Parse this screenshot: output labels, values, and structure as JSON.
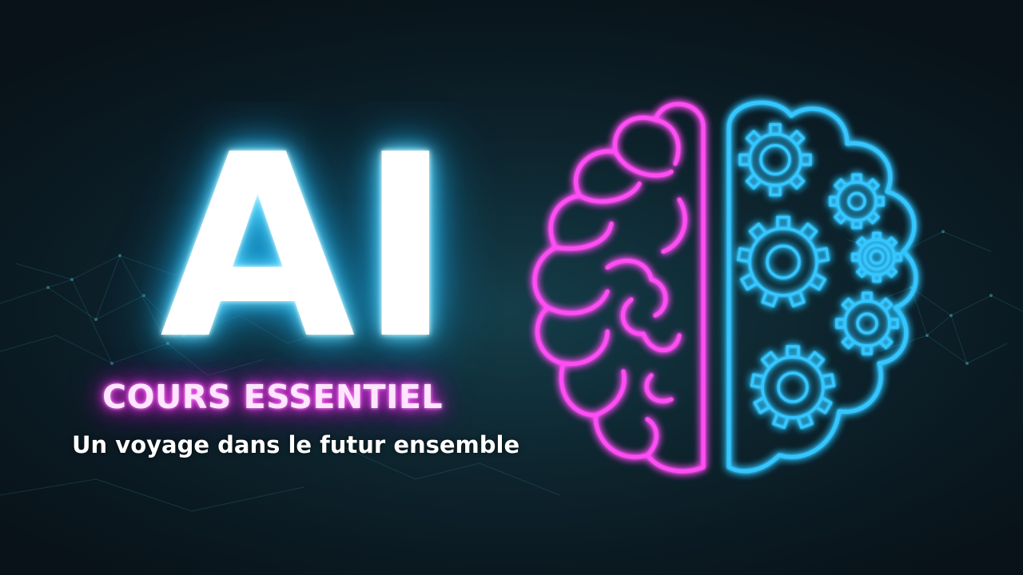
{
  "hero": {
    "title": "AI",
    "course_label": "COURS ESSENTIEL",
    "tagline": "Un voyage dans le futur ensemble"
  },
  "graphic": {
    "name": "brain-gears-icon",
    "left_color": "#ff4ef4",
    "right_color": "#36c6ff"
  },
  "colors": {
    "background": "#0b1a22",
    "title_glow": "#2bc4ff",
    "course_glow": "#e21ce0",
    "tagline": "#ffffff"
  }
}
